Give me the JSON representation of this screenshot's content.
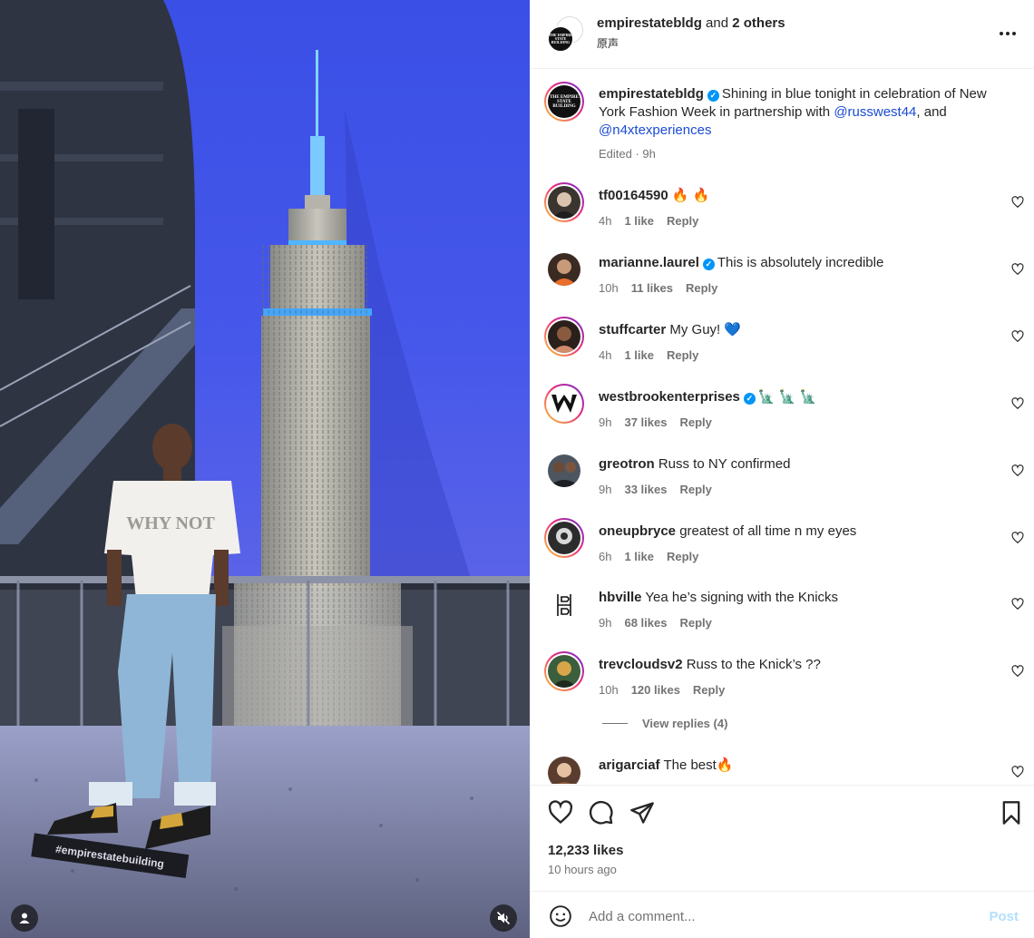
{
  "media": {
    "floor_tag": "#empirestatebuilding",
    "shirt_text": "WHY NOT"
  },
  "header": {
    "owner": "empirestatebldg",
    "and_text": "and",
    "others": "2 others",
    "audio": "原声",
    "owner_logo_text": "THE EMPIRE STATE BUILDING"
  },
  "caption": {
    "username": "empirestatebldg",
    "text_before": "Shining in blue tonight in celebration of New York Fashion Week in partnership with",
    "mention1": "@russwest44",
    "text_mid": ", and",
    "mention2": "@n4xtexperiences",
    "meta": "Edited · 9h"
  },
  "comments": [
    {
      "username": "tf00164590",
      "text": "🔥 🔥",
      "time": "4h",
      "likes": "1 like",
      "reply": "Reply"
    },
    {
      "username": "marianne.laurel",
      "text": "This is absolutely incredible",
      "time": "10h",
      "likes": "11 likes",
      "reply": "Reply"
    },
    {
      "username": "stuffcarter",
      "text": "My Guy! 💙",
      "time": "4h",
      "likes": "1 like",
      "reply": "Reply"
    },
    {
      "username": "westbrookenterprises",
      "text": "🗽 🗽 🗽",
      "time": "9h",
      "likes": "37 likes",
      "reply": "Reply"
    },
    {
      "username": "greotron",
      "text": "Russ to NY confirmed",
      "time": "9h",
      "likes": "33 likes",
      "reply": "Reply"
    },
    {
      "username": "oneupbryce",
      "text": "greatest of all time n my eyes",
      "time": "6h",
      "likes": "1 like",
      "reply": "Reply"
    },
    {
      "username": "hbville",
      "text": "Yea he’s signing with the Knicks",
      "time": "9h",
      "likes": "68 likes",
      "reply": "Reply"
    },
    {
      "username": "trevcloudsv2",
      "text": "Russ to the Knick’s ??",
      "time": "10h",
      "likes": "120 likes",
      "reply": "Reply"
    },
    {
      "username": "arigarciaf",
      "text": "The best🔥"
    }
  ],
  "view_replies": "View replies (4)",
  "likes_count": "12,233 likes",
  "time_ago": "10 hours ago",
  "add_comment": {
    "placeholder": "Add a comment...",
    "post_label": "Post"
  },
  "colors": {
    "accent": "#0095f6",
    "post_disabled": "#b2dffc",
    "mention": "#1a4bd4",
    "sky_blue": "#3f52e6"
  }
}
